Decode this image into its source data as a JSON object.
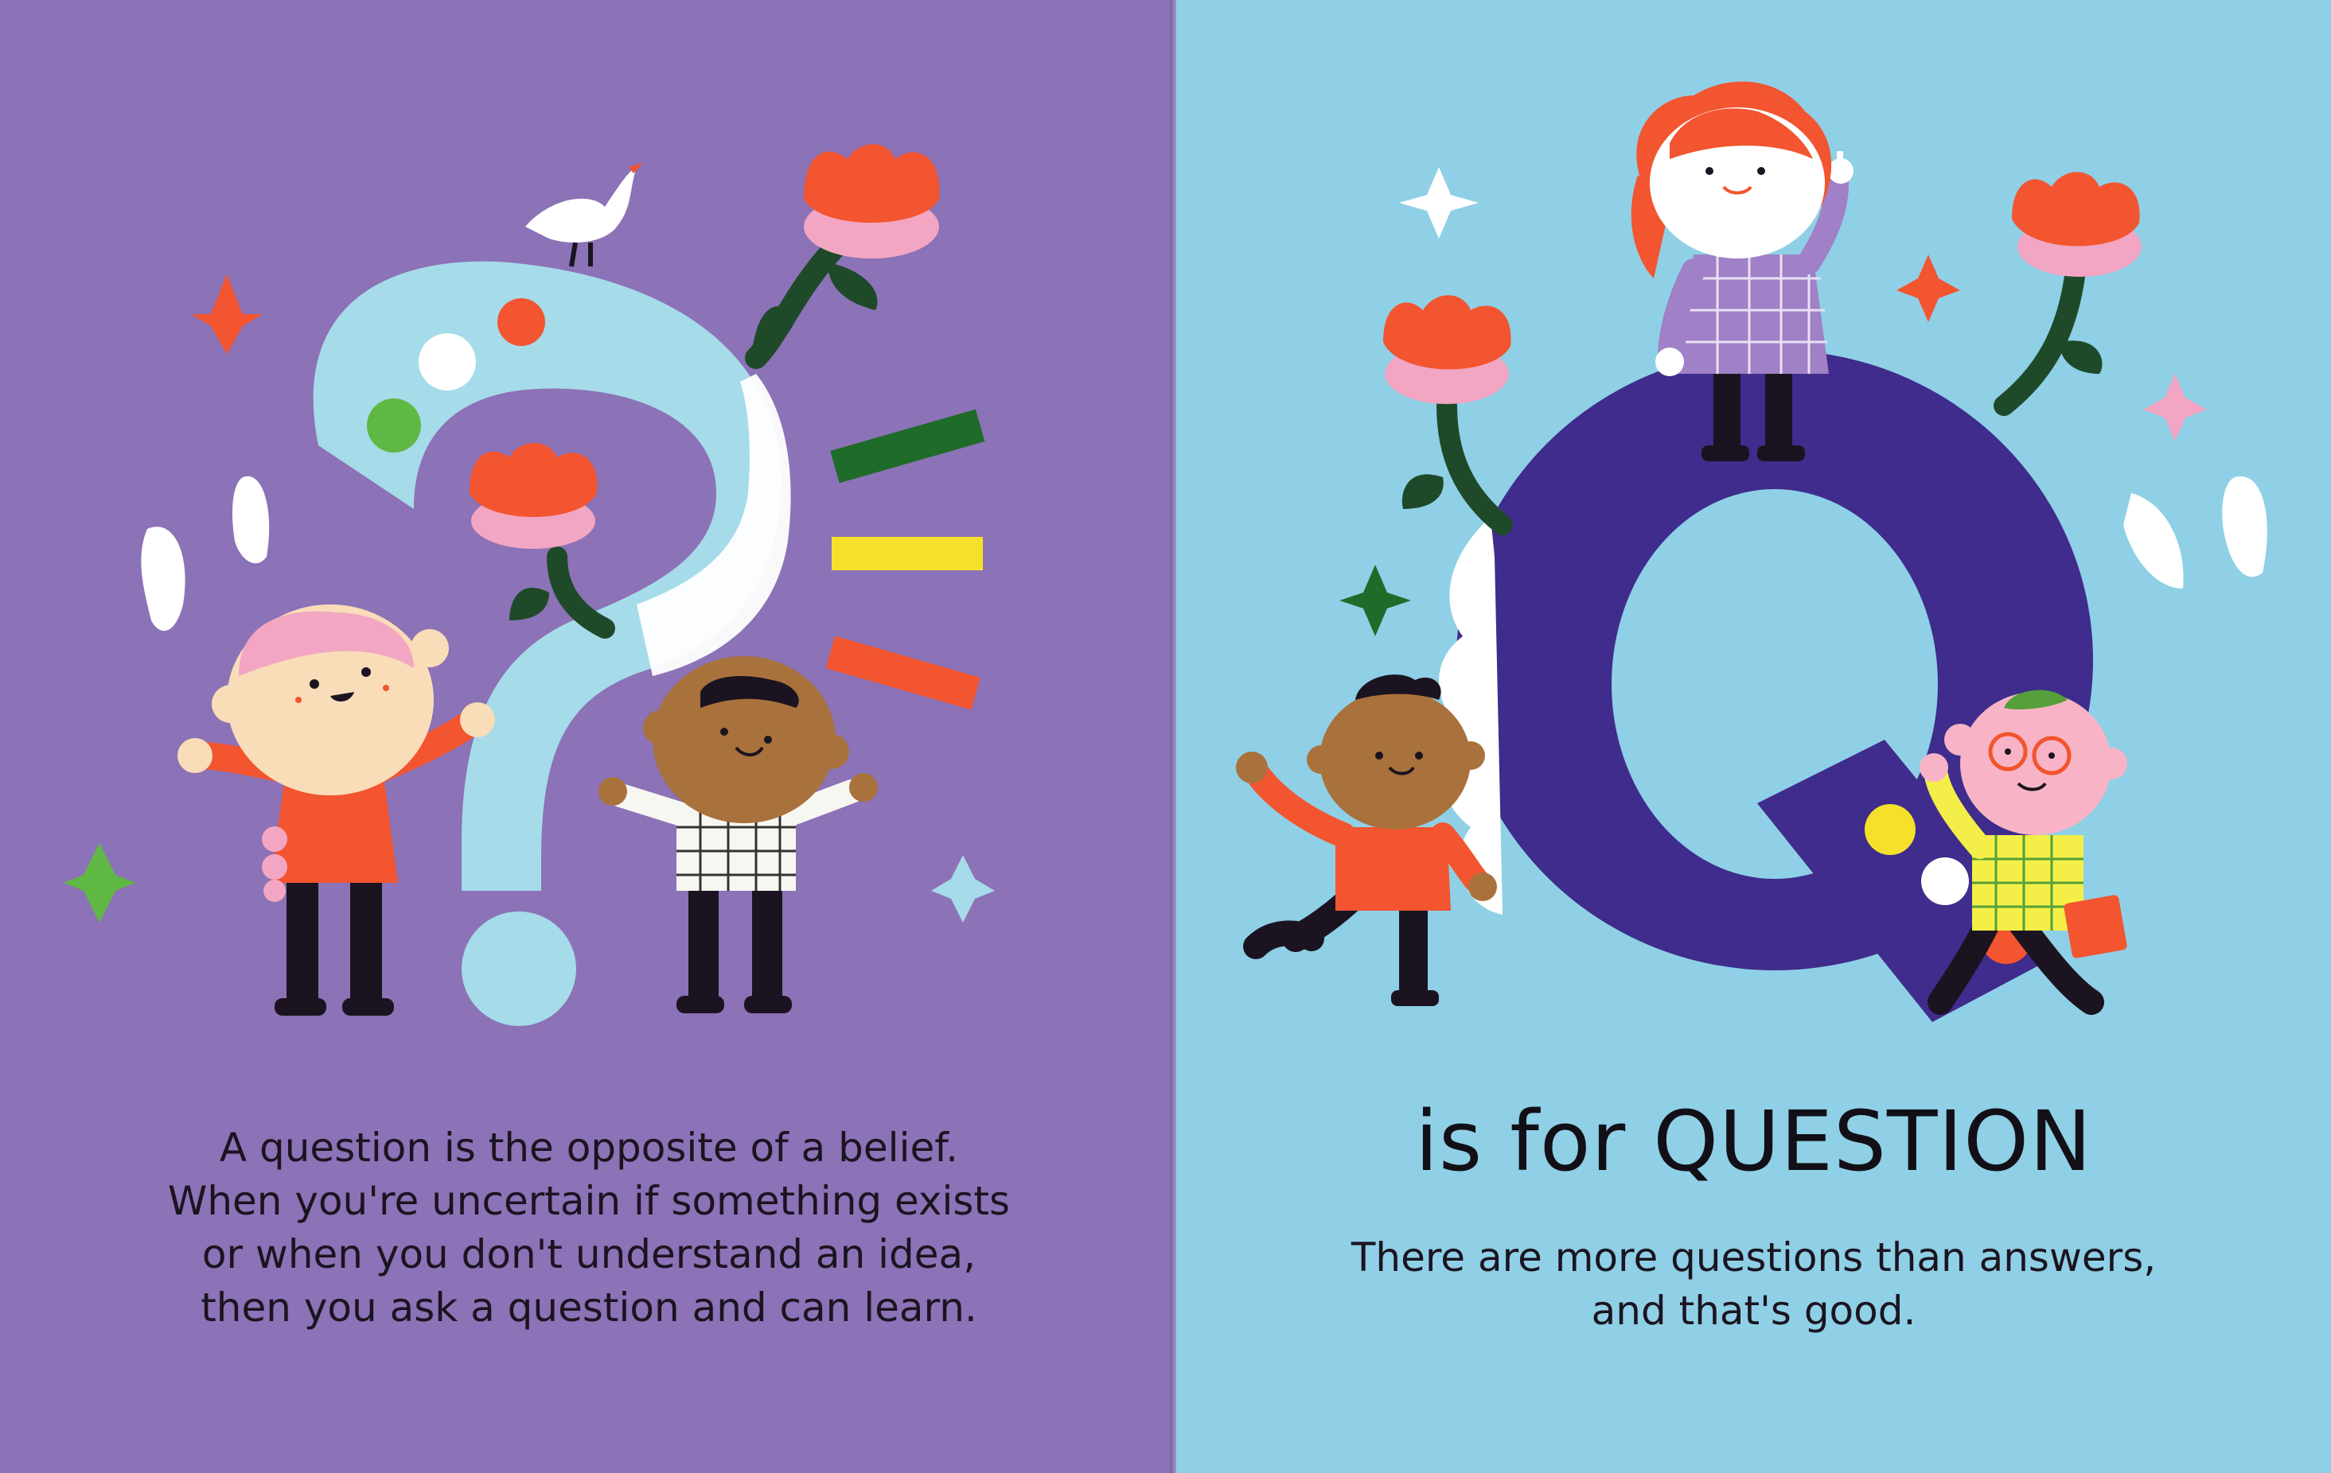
{
  "colors": {
    "left_page_bg": "#8c72b6",
    "right_page_bg": "#8fd0e6",
    "question_mark": "#a6dbe9",
    "letter_q": "#3f2c8c",
    "flower": "#f2552f",
    "flower_pink": "#f3a6c3",
    "stem": "#1f4a2a"
  },
  "left_page": {
    "illustration": {
      "icons": [
        "question-mark-icon",
        "bird-icon",
        "flower-icon",
        "sparkle-icon",
        "child-icon",
        "exclamation-strokes-icon"
      ]
    },
    "body_lines": [
      "A question is the opposite of a belief.",
      "When you're uncertain if something exists",
      "or when you don't understand an idea,",
      "then you ask a question and can learn."
    ]
  },
  "right_page": {
    "illustration": {
      "icons": [
        "letter-q-icon",
        "flower-icon",
        "sparkle-icon",
        "child-icon",
        "book-icon"
      ]
    },
    "heading": "is for QUESTION",
    "body_lines": [
      "There are more questions than answers,",
      "and that's good."
    ]
  }
}
